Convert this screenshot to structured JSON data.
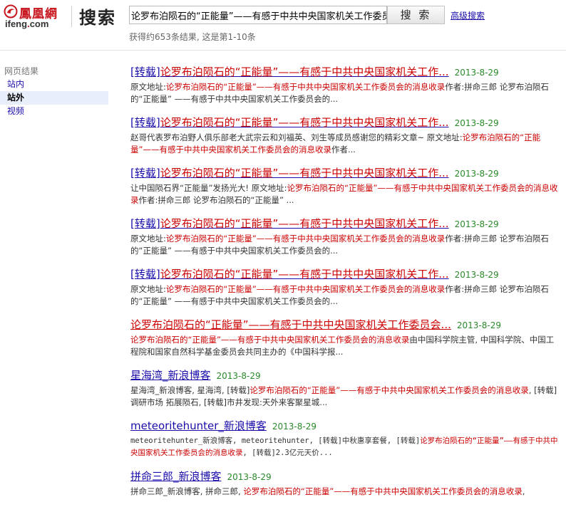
{
  "header": {
    "logo_cn": "鳳凰網",
    "logo_en_a": "ifeng",
    "logo_en_dot": ".",
    "logo_en_b": "com",
    "title": "搜索",
    "search_value": "论罗布泊陨石的“正能量”——有感于中共中央国家机关工作委员会的消息收录",
    "search_button": "搜 索",
    "advanced_search": "高级搜索",
    "result_count": "获得约653条结果, 这是第1-10条"
  },
  "sidebar": {
    "title": "网页结果",
    "items": [
      {
        "label": "站内",
        "active": false
      },
      {
        "label": "站外",
        "active": true
      },
      {
        "label": "视频",
        "active": false
      }
    ]
  },
  "results": [
    {
      "title_prefix": "[转载]",
      "title_main": "论罗布泊陨石的“正能量”——有感于中共中央国家机关工作...",
      "date": "2013-8-29",
      "snippet": [
        {
          "t": "原文地址:"
        },
        {
          "t": "论罗布泊陨石的“正能量”——有感于中共中央国家机关工作委员会的消息收录",
          "hl": true
        },
        {
          "t": "作者:拼命三郎 论罗布泊陨石的“正能量” ——有感于中共中央国家机关工作委员会的..."
        }
      ]
    },
    {
      "title_prefix": "[转载]",
      "title_main": "论罗布泊陨石的“正能量”——有感于中共中央国家机关工作...",
      "date": "2013-8-29",
      "snippet": [
        {
          "t": "赵哥代表罗布泊野人俱乐部老大武宗云和刘福英、刘生等成员感谢您的精彩文章~ 原文地址:"
        },
        {
          "t": "论罗布泊陨石的“正能量”——有感于中共中央国家机关工作委员会的消息收录",
          "hl": true
        },
        {
          "t": "作者..."
        }
      ]
    },
    {
      "title_prefix": "[转载]",
      "title_main": "论罗布泊陨石的“正能量”——有感于中共中央国家机关工作...",
      "date": "2013-8-29",
      "snippet": [
        {
          "t": "让中国陨石界“正能量”发扬光大! 原文地址:"
        },
        {
          "t": "论罗布泊陨石的“正能量”——有感于中共中央国家机关工作委员会的消息收录",
          "hl": true
        },
        {
          "t": "作者:拼命三郎 论罗布泊陨石的“正能量” ..."
        }
      ]
    },
    {
      "title_prefix": "[转载]",
      "title_main": "论罗布泊陨石的“正能量”——有感于中共中央国家机关工作...",
      "date": "2013-8-29",
      "snippet": [
        {
          "t": "原文地址:"
        },
        {
          "t": "论罗布泊陨石的“正能量”——有感于中共中央国家机关工作委员会的消息收录",
          "hl": true
        },
        {
          "t": "作者:拼命三郎 论罗布泊陨石的“正能量” ——有感于中共中央国家机关工作委员会的..."
        }
      ]
    },
    {
      "title_prefix": "[转载]",
      "title_main": "论罗布泊陨石的“正能量”——有感于中共中央国家机关工作...",
      "date": "2013-8-29",
      "snippet": [
        {
          "t": "原文地址:"
        },
        {
          "t": "论罗布泊陨石的“正能量”——有感于中共中央国家机关工作委员会的消息收录",
          "hl": true
        },
        {
          "t": "作者:拼命三郎 论罗布泊陨石的“正能量” ——有感于中共中央国家机关工作委员会的..."
        }
      ]
    },
    {
      "title_prefix": "",
      "title_main": "论罗布泊陨石的“正能量”——有感于中共中央国家机关工作委员会...",
      "date": "2013-8-29",
      "plain": true,
      "snippet": [
        {
          "t": "论罗布泊陨石的“正能量”——有感于中共中央国家机关工作委员会的消息收录",
          "hl": true
        },
        {
          "t": "由中国科学院主管, 中国科学院、中国工程院和国家自然科学基金委员会共同主办的《中国科学报..."
        }
      ]
    },
    {
      "title_prefix": "",
      "title_main": "星海湾_新浪博客",
      "date": "2013-8-29",
      "link": true,
      "snippet": [
        {
          "t": "星海湾_新浪博客, 星海湾, [转载]"
        },
        {
          "t": "论罗布泊陨石的“正能量”——有感于中共中央国家机关工作委员会的消息收录",
          "hl": true
        },
        {
          "t": ", [转载]调研市场 拓展陨石, [转载]市井发现:天外来客聚星城..."
        }
      ]
    },
    {
      "title_prefix": "",
      "title_main": "meteoritehunter_新浪博客",
      "date": "2013-8-29",
      "link": true,
      "mono": true,
      "snippet": [
        {
          "t": "meteoritehunter_新浪博客, meteoritehunter, [转载]中秋惠享套餐, [转载]"
        },
        {
          "t": "论罗布泊陨石的“正能量”——有感于中共中央国家机关工作委员会的消息收录",
          "hl": true
        },
        {
          "t": ", [转载]2.3亿元天价..."
        }
      ]
    },
    {
      "title_prefix": "",
      "title_main": "拼命三郎_新浪博客",
      "date": "2013-8-29",
      "link": true,
      "snippet": [
        {
          "t": "拼命三郎_新浪博客, 拼命三郎, "
        },
        {
          "t": "论罗布泊陨石的“正能量”——有感于中共中央国家机关工作委员会的消息收录",
          "hl": true
        },
        {
          "t": ","
        }
      ]
    }
  ],
  "colors": {
    "link": "#1a0dab",
    "highlight": "#cc0000",
    "date": "#2a8a2a",
    "brand": "#c8161e"
  },
  "icons": {
    "logo": "phoenix-logo-icon"
  }
}
